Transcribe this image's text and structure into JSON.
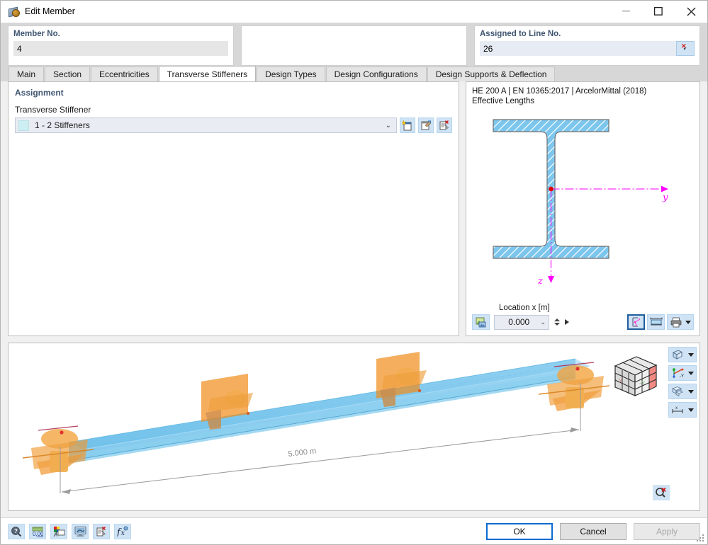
{
  "window": {
    "title": "Edit Member",
    "icon": "member-icon",
    "controls": {
      "minimize": "minimize-icon",
      "maximize": "maximize-icon",
      "close": "close-icon"
    }
  },
  "header": {
    "member": {
      "label": "Member No.",
      "value": "4"
    },
    "middle": {
      "label": "",
      "value": ""
    },
    "line": {
      "label": "Assigned to Line No.",
      "value": "26",
      "pick_icon": "pick-cursor-icon"
    }
  },
  "tabs": [
    {
      "label": "Main",
      "active": false
    },
    {
      "label": "Section",
      "active": false
    },
    {
      "label": "Eccentricities",
      "active": false
    },
    {
      "label": "Transverse Stiffeners",
      "active": true
    },
    {
      "label": "Design Types",
      "active": false
    },
    {
      "label": "Design Configurations",
      "active": false
    },
    {
      "label": "Design Supports & Deflection",
      "active": false
    }
  ],
  "assignment": {
    "section_title": "Assignment",
    "field_label": "Transverse Stiffener",
    "combo_value": "1 - 2 Stiffeners",
    "combo_caret": "chevron-down-icon",
    "buttons": [
      {
        "name": "new-stiffener-button",
        "icon": "new-document-icon"
      },
      {
        "name": "edit-stiffener-button",
        "icon": "edit-document-icon"
      },
      {
        "name": "delete-stiffener-button",
        "icon": "delete-document-icon"
      }
    ]
  },
  "preview": {
    "title_line1": "HE 200 A | EN 10365:2017 | ArcelorMittal (2018)",
    "title_line2": "Effective Lengths",
    "axis_y": "y",
    "axis_z": "z",
    "location_label": "Location x [m]",
    "location_value": "0.000",
    "render_button": "render-image-icon",
    "footer_buttons": [
      {
        "name": "section-properties-button",
        "icon": "section-axes-icon",
        "selected": true
      },
      {
        "name": "dimensions-button",
        "icon": "dimension-icon",
        "selected": false
      },
      {
        "name": "print-button",
        "icon": "printer-icon",
        "selected": false
      }
    ]
  },
  "viewport": {
    "dimension_label": "5.000 m",
    "nav_cube": "view-cube-icon",
    "tools": [
      {
        "name": "view-mode-button",
        "icon": "wireframe-cube-icon"
      },
      {
        "name": "view-direction-button",
        "icon": "axes-minus-y-icon",
        "text": "-Y"
      },
      {
        "name": "render-style-button",
        "icon": "solid-blocks-icon"
      },
      {
        "name": "dimension-display-button",
        "icon": "measure-icon"
      }
    ],
    "zoom_reset": {
      "name": "clear-zoom-button",
      "icon": "zoom-delete-icon"
    }
  },
  "bottombar": {
    "icons": [
      {
        "name": "info-button",
        "icon": "question-magnifier-icon"
      },
      {
        "name": "units-button",
        "icon": "ruler-number-icon"
      },
      {
        "name": "display-properties-button",
        "icon": "color-properties-icon"
      },
      {
        "name": "view-settings-button",
        "icon": "monitor-icon"
      },
      {
        "name": "delete-entry-button",
        "icon": "document-delete-icon"
      },
      {
        "name": "formula-button",
        "icon": "function-icon"
      }
    ],
    "ok": "OK",
    "cancel": "Cancel",
    "apply": "Apply"
  }
}
